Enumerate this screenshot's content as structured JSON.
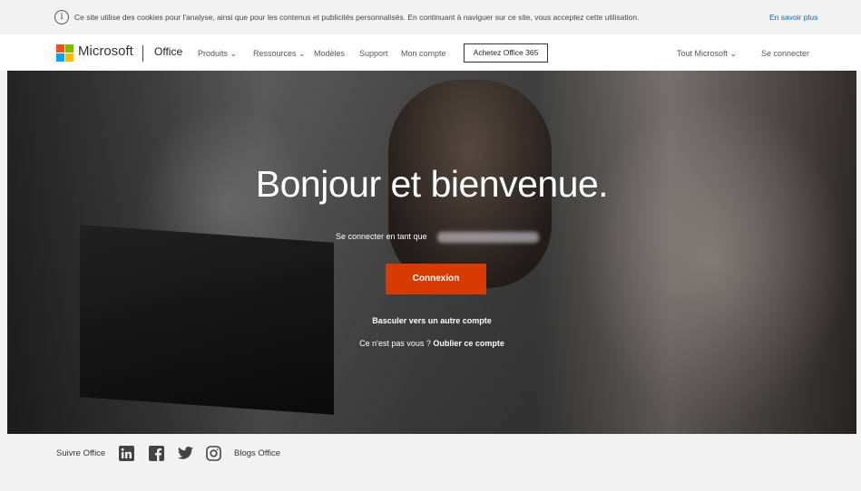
{
  "cookie_bar": {
    "text": "Ce site utilise des cookies pour l'analyse, ainsi que pour les contenus et publicités personnalisés. En continuant à naviguer sur ce site, vous acceptez cette utilisation.",
    "learn_more": "En savoir plus"
  },
  "nav": {
    "brand": "Microsoft",
    "office": "Office",
    "products": "Produits ⌄",
    "resources": "Ressources ⌄",
    "templates": "Modèles",
    "support": "Support",
    "my_account": "Mon compte",
    "buy": "Achetez Office 365",
    "all_microsoft": "Tout Microsoft ⌄",
    "sign_in": "Se connecter"
  },
  "hero": {
    "title": "Bonjour et bienvenue.",
    "signed_as": "Se connecter en tant que",
    "signin_button": "Connexion",
    "switch_account": "Basculer vers un autre compte",
    "not_you": "Ce n'est pas vous ?",
    "forget_account": "Oublier ce compte"
  },
  "footer": {
    "follow": "Suivre Office",
    "blogs": "Blogs Office"
  },
  "colors": {
    "accent_orange": "#d83b01",
    "link_blue": "#0067b8",
    "logo_red": "#f25022",
    "logo_green": "#7fba00",
    "logo_blue": "#00a4ef",
    "logo_yellow": "#ffb900"
  }
}
